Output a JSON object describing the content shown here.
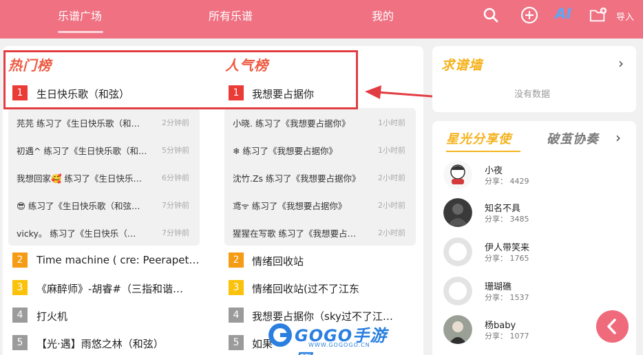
{
  "header": {
    "tabs": [
      {
        "label": "乐谱广场",
        "active": true
      },
      {
        "label": "所有乐谱"
      },
      {
        "label": "我的"
      }
    ],
    "icons": [
      "search-icon",
      "add-icon",
      "ai-icon",
      "folder-add-icon"
    ],
    "import_label": "导入",
    "ai_label": "AI"
  },
  "hot": {
    "title": "热门榜",
    "top": {
      "rank": "1",
      "name": "生日快乐歌（和弦）"
    },
    "activity": [
      {
        "text": "芫芫 练习了《生日快乐歌（和…",
        "time": "2分钟前"
      },
      {
        "text": "初遇^ 练习了《生日快乐歌（和…",
        "time": "5分钟前"
      },
      {
        "text": "我想回家🥰 练习了《生日快乐…",
        "time": "6分钟前"
      },
      {
        "text": "😎 练习了《生日快乐歌（和弦…",
        "time": "7分钟前"
      },
      {
        "text": "vicky。 练习了《生日快乐（…",
        "time": "7分钟前"
      }
    ],
    "items": [
      {
        "rank": "2",
        "name": "Time machine ( cre: Peerapet…"
      },
      {
        "rank": "3",
        "name": "《麻醉师》-胡睿#（三指和谐…"
      },
      {
        "rank": "4",
        "name": "打火机"
      },
      {
        "rank": "5",
        "name": "【光·遇】雨悠之林（和弦）"
      }
    ]
  },
  "popular": {
    "title": "人气榜",
    "top": {
      "rank": "1",
      "name": "我想要占据你"
    },
    "activity": [
      {
        "text": "小晓. 练习了《我想要占据你》",
        "time": "1小时前"
      },
      {
        "text": "❄ 练习了《我想要占据你》",
        "time": "1小时前"
      },
      {
        "text": "沈竹.Zs 练习了《我想要占据你》",
        "time": "2小时前"
      },
      {
        "text": "鸢ᯤ 练习了《我想要占据你》",
        "time": "2小时前"
      },
      {
        "text": "猩猩在写歌 练习了《我想要占…",
        "time": "2小时前"
      }
    ],
    "items": [
      {
        "rank": "2",
        "name": "情绪回收站"
      },
      {
        "rank": "3",
        "name": "情绪回收站(过不了江东"
      },
      {
        "rank": "4",
        "name": "我想要占据你（sky过不了江…"
      },
      {
        "rank": "5",
        "name": "如果"
      }
    ]
  },
  "request_wall": {
    "title": "求谱墙",
    "empty": "没有数据"
  },
  "sharers": {
    "tab_active": "星光分享使",
    "tab_other": "破茧协奏",
    "users": [
      {
        "name": "小夜",
        "share": "分享： 4429"
      },
      {
        "name": "知名不具",
        "share": "分享： 3485"
      },
      {
        "name": "伊人带笑来",
        "share": "分享： 1765"
      },
      {
        "name": "珊瑚礁",
        "share": "分享： 1537"
      },
      {
        "name": "杨baby",
        "share": "分享： 1077"
      }
    ]
  },
  "watermark": {
    "text": "GOGO手游网",
    "sub": "WWW.GOGOGO.CN"
  },
  "colors": {
    "header": "#ef7182",
    "highlight": "#e13c41",
    "title_red": "#ee5a42",
    "title_yellow": "#f5b21b"
  }
}
